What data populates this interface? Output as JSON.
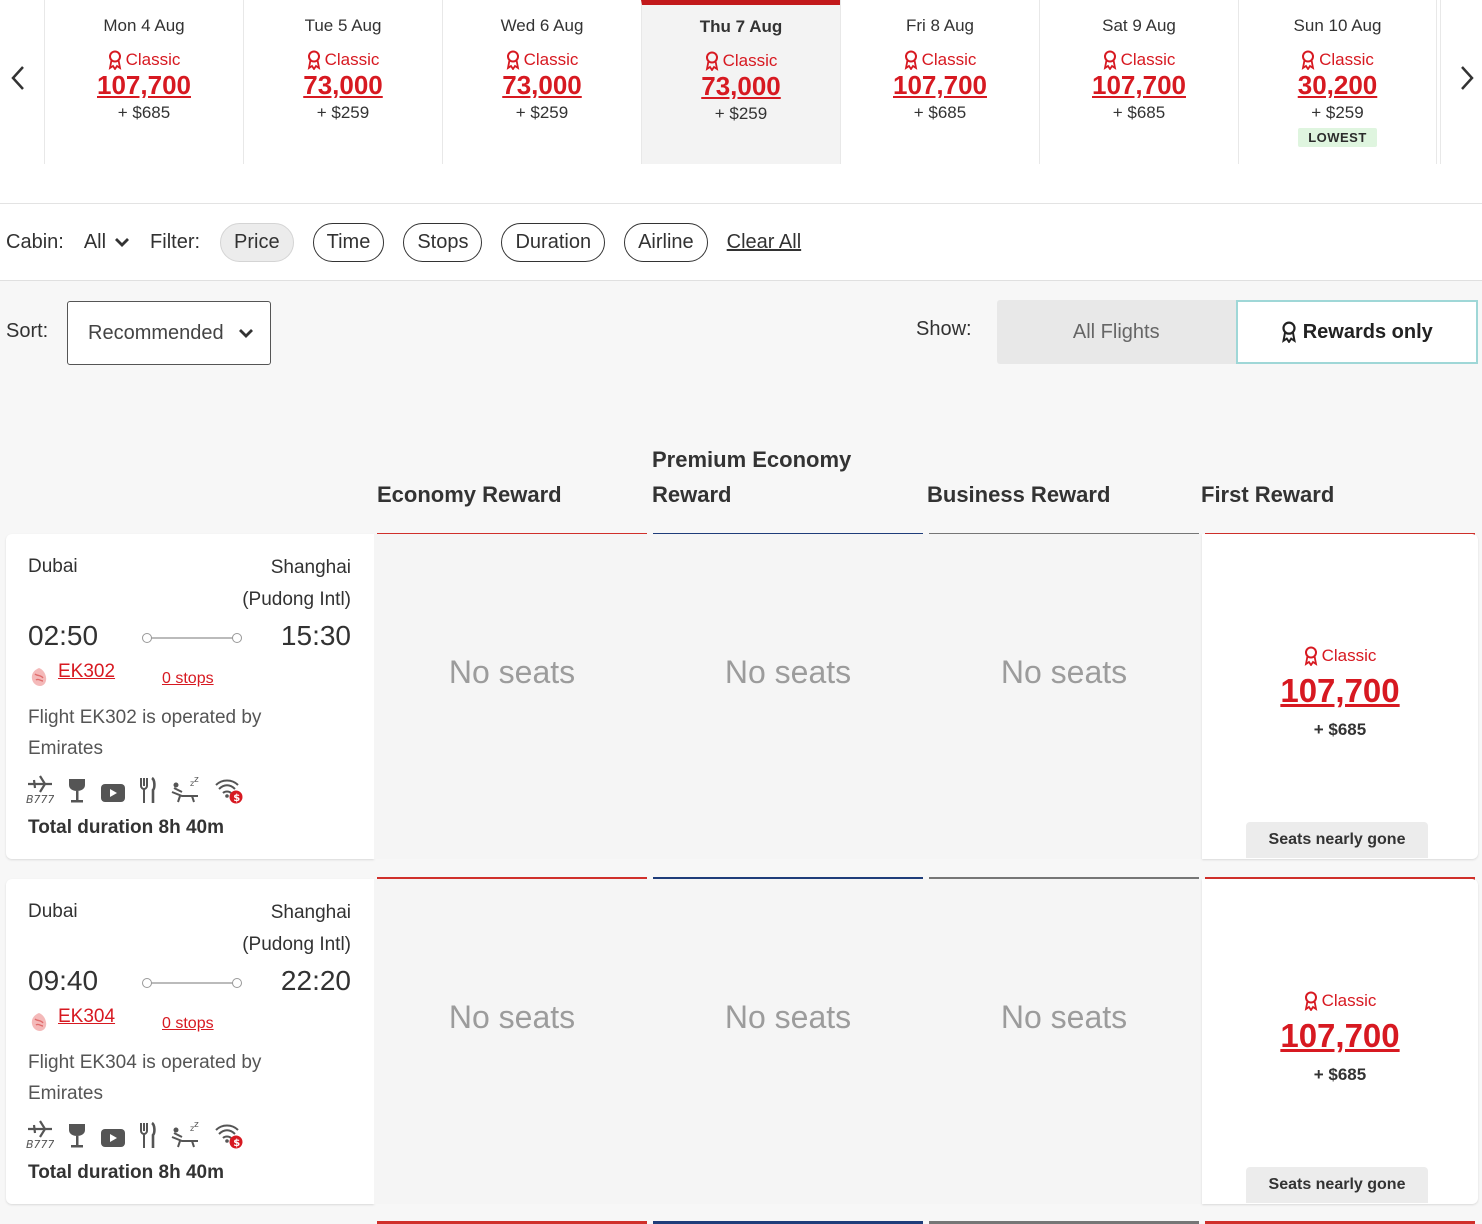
{
  "carousel": {
    "days": [
      {
        "label": "Mon 4 Aug",
        "fare_type": "Classic",
        "points": "107,700",
        "cash": "+ $685"
      },
      {
        "label": "Tue 5 Aug",
        "fare_type": "Classic",
        "points": "73,000",
        "cash": "+ $259"
      },
      {
        "label": "Wed 6 Aug",
        "fare_type": "Classic",
        "points": "73,000",
        "cash": "+ $259"
      },
      {
        "label": "Thu 7 Aug",
        "fare_type": "Classic",
        "points": "73,000",
        "cash": "+ $259"
      },
      {
        "label": "Fri 8 Aug",
        "fare_type": "Classic",
        "points": "107,700",
        "cash": "+ $685"
      },
      {
        "label": "Sat 9 Aug",
        "fare_type": "Classic",
        "points": "107,700",
        "cash": "+ $685"
      },
      {
        "label": "Sun 10 Aug",
        "fare_type": "Classic",
        "points": "30,200",
        "cash": "+ $259",
        "badge": "LOWEST"
      }
    ],
    "selected_index": 3
  },
  "filters": {
    "cabin_label": "Cabin:",
    "cabin_value": "All",
    "filter_label": "Filter:",
    "chips": [
      "Price",
      "Time",
      "Stops",
      "Duration",
      "Airline"
    ],
    "active_chip": "Price",
    "clear_label": "Clear All"
  },
  "sort": {
    "label": "Sort:",
    "value": "Recommended"
  },
  "show": {
    "label": "Show:",
    "options": [
      "All Flights",
      "Rewards only"
    ],
    "selected": "Rewards only"
  },
  "columns": [
    {
      "title": "Economy Reward",
      "color": "#d0302b"
    },
    {
      "title": "Premium Economy Reward",
      "color": "#1f3d7a"
    },
    {
      "title": "Business Reward",
      "color": "#767676"
    },
    {
      "title": "First Reward",
      "color": "#d0302b"
    }
  ],
  "colors": {
    "accent_red": "#d71921",
    "lowest_badge": "#dff5df",
    "toggle_border": "#9fd7d7"
  },
  "flights": [
    {
      "origin": "Dubai",
      "destination_line1": "Shanghai",
      "destination_line2": "(Pudong Intl)",
      "departure": "02:50",
      "arrival": "15:30",
      "flight_number": "EK302",
      "stops": "0 stops",
      "operated_by": "Flight EK302 is operated by Emirates",
      "aircraft": "B777",
      "amenities": [
        "aircraft-icon",
        "drinks-icon",
        "entertainment-icon",
        "dining-icon",
        "flat-bed-icon",
        "paid-wifi-icon"
      ],
      "duration": "Total duration 8h 40m",
      "economy": "No seats",
      "premium_economy": "No seats",
      "business": "No seats",
      "first": {
        "fare_type": "Classic",
        "points": "107,700",
        "cash": "+ $685",
        "availability": "Seats nearly gone"
      }
    },
    {
      "origin": "Dubai",
      "destination_line1": "Shanghai",
      "destination_line2": "(Pudong Intl)",
      "departure": "09:40",
      "arrival": "22:20",
      "flight_number": "EK304",
      "stops": "0 stops",
      "operated_by": "Flight EK304 is operated by Emirates",
      "aircraft": "B777",
      "amenities": [
        "aircraft-icon",
        "drinks-icon",
        "entertainment-icon",
        "dining-icon",
        "flat-bed-icon",
        "paid-wifi-icon"
      ],
      "duration": "Total duration 8h 40m",
      "economy": "No seats",
      "premium_economy": "No seats",
      "business": "No seats",
      "first": {
        "fare_type": "Classic",
        "points": "107,700",
        "cash": "+ $685",
        "availability": "Seats nearly gone"
      }
    }
  ]
}
